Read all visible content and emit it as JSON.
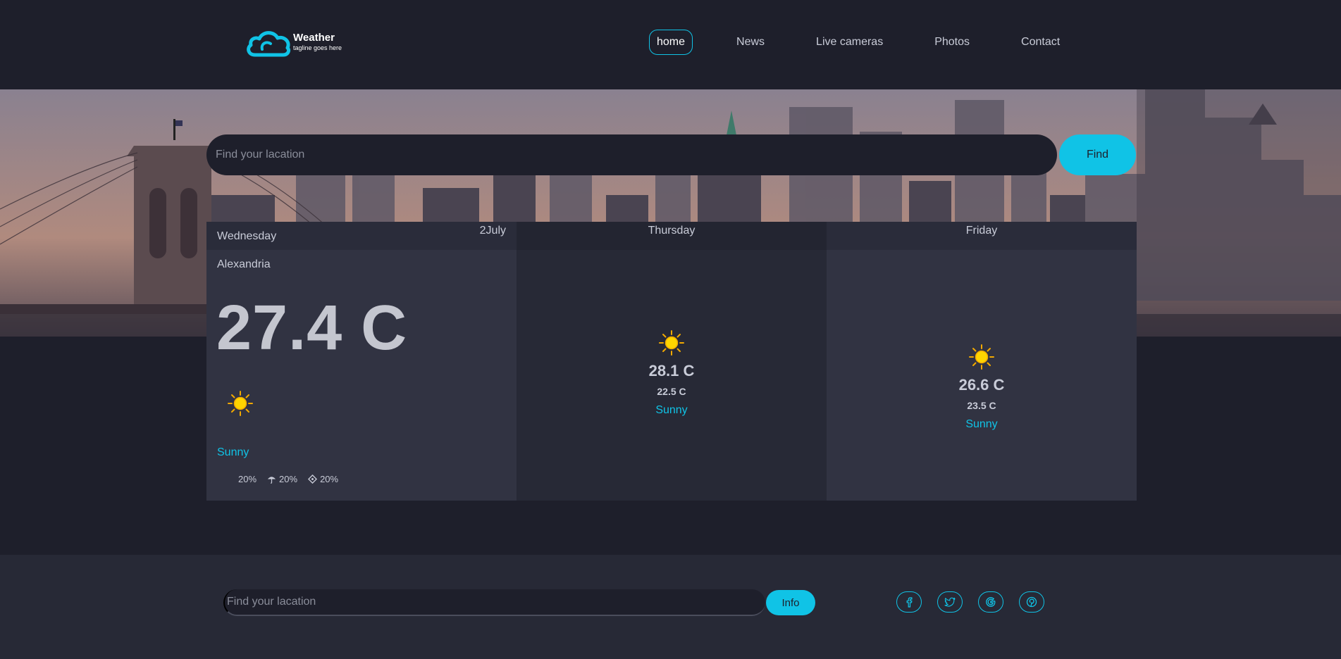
{
  "brand": {
    "title": "Weather",
    "tagline": "tagline goes here",
    "accent_color": "#10c3e6"
  },
  "nav": {
    "items": [
      {
        "label": "home",
        "active": true
      },
      {
        "label": "News",
        "active": false
      },
      {
        "label": "Live cameras",
        "active": false
      },
      {
        "label": "Photos",
        "active": false
      },
      {
        "label": "Contact",
        "active": false
      }
    ]
  },
  "search": {
    "placeholder": "Find your lacation",
    "button_label": "Find"
  },
  "forecast": {
    "today": {
      "day": "Wednesday",
      "date": "2July",
      "location": "Alexandria",
      "temp": "27.4 C",
      "icon": "sun-icon",
      "description": "Sunny",
      "stats": [
        {
          "icon": "",
          "value": "20%"
        },
        {
          "icon": "umbrella-icon",
          "value": "20%"
        },
        {
          "icon": "compass-icon",
          "value": "20%"
        }
      ]
    },
    "days": [
      {
        "day": "Thursday",
        "icon": "sun-icon",
        "max": "28.1 C",
        "min": "22.5 C",
        "description": "Sunny"
      },
      {
        "day": "Friday",
        "icon": "sun-icon",
        "max": "26.6 C",
        "min": "23.5 C",
        "description": "Sunny"
      }
    ]
  },
  "footer": {
    "placeholder": "Find your lacation",
    "button_label": "Info",
    "socials": [
      "facebook-icon",
      "twitter-icon",
      "google-icon",
      "pinterest-icon"
    ]
  }
}
